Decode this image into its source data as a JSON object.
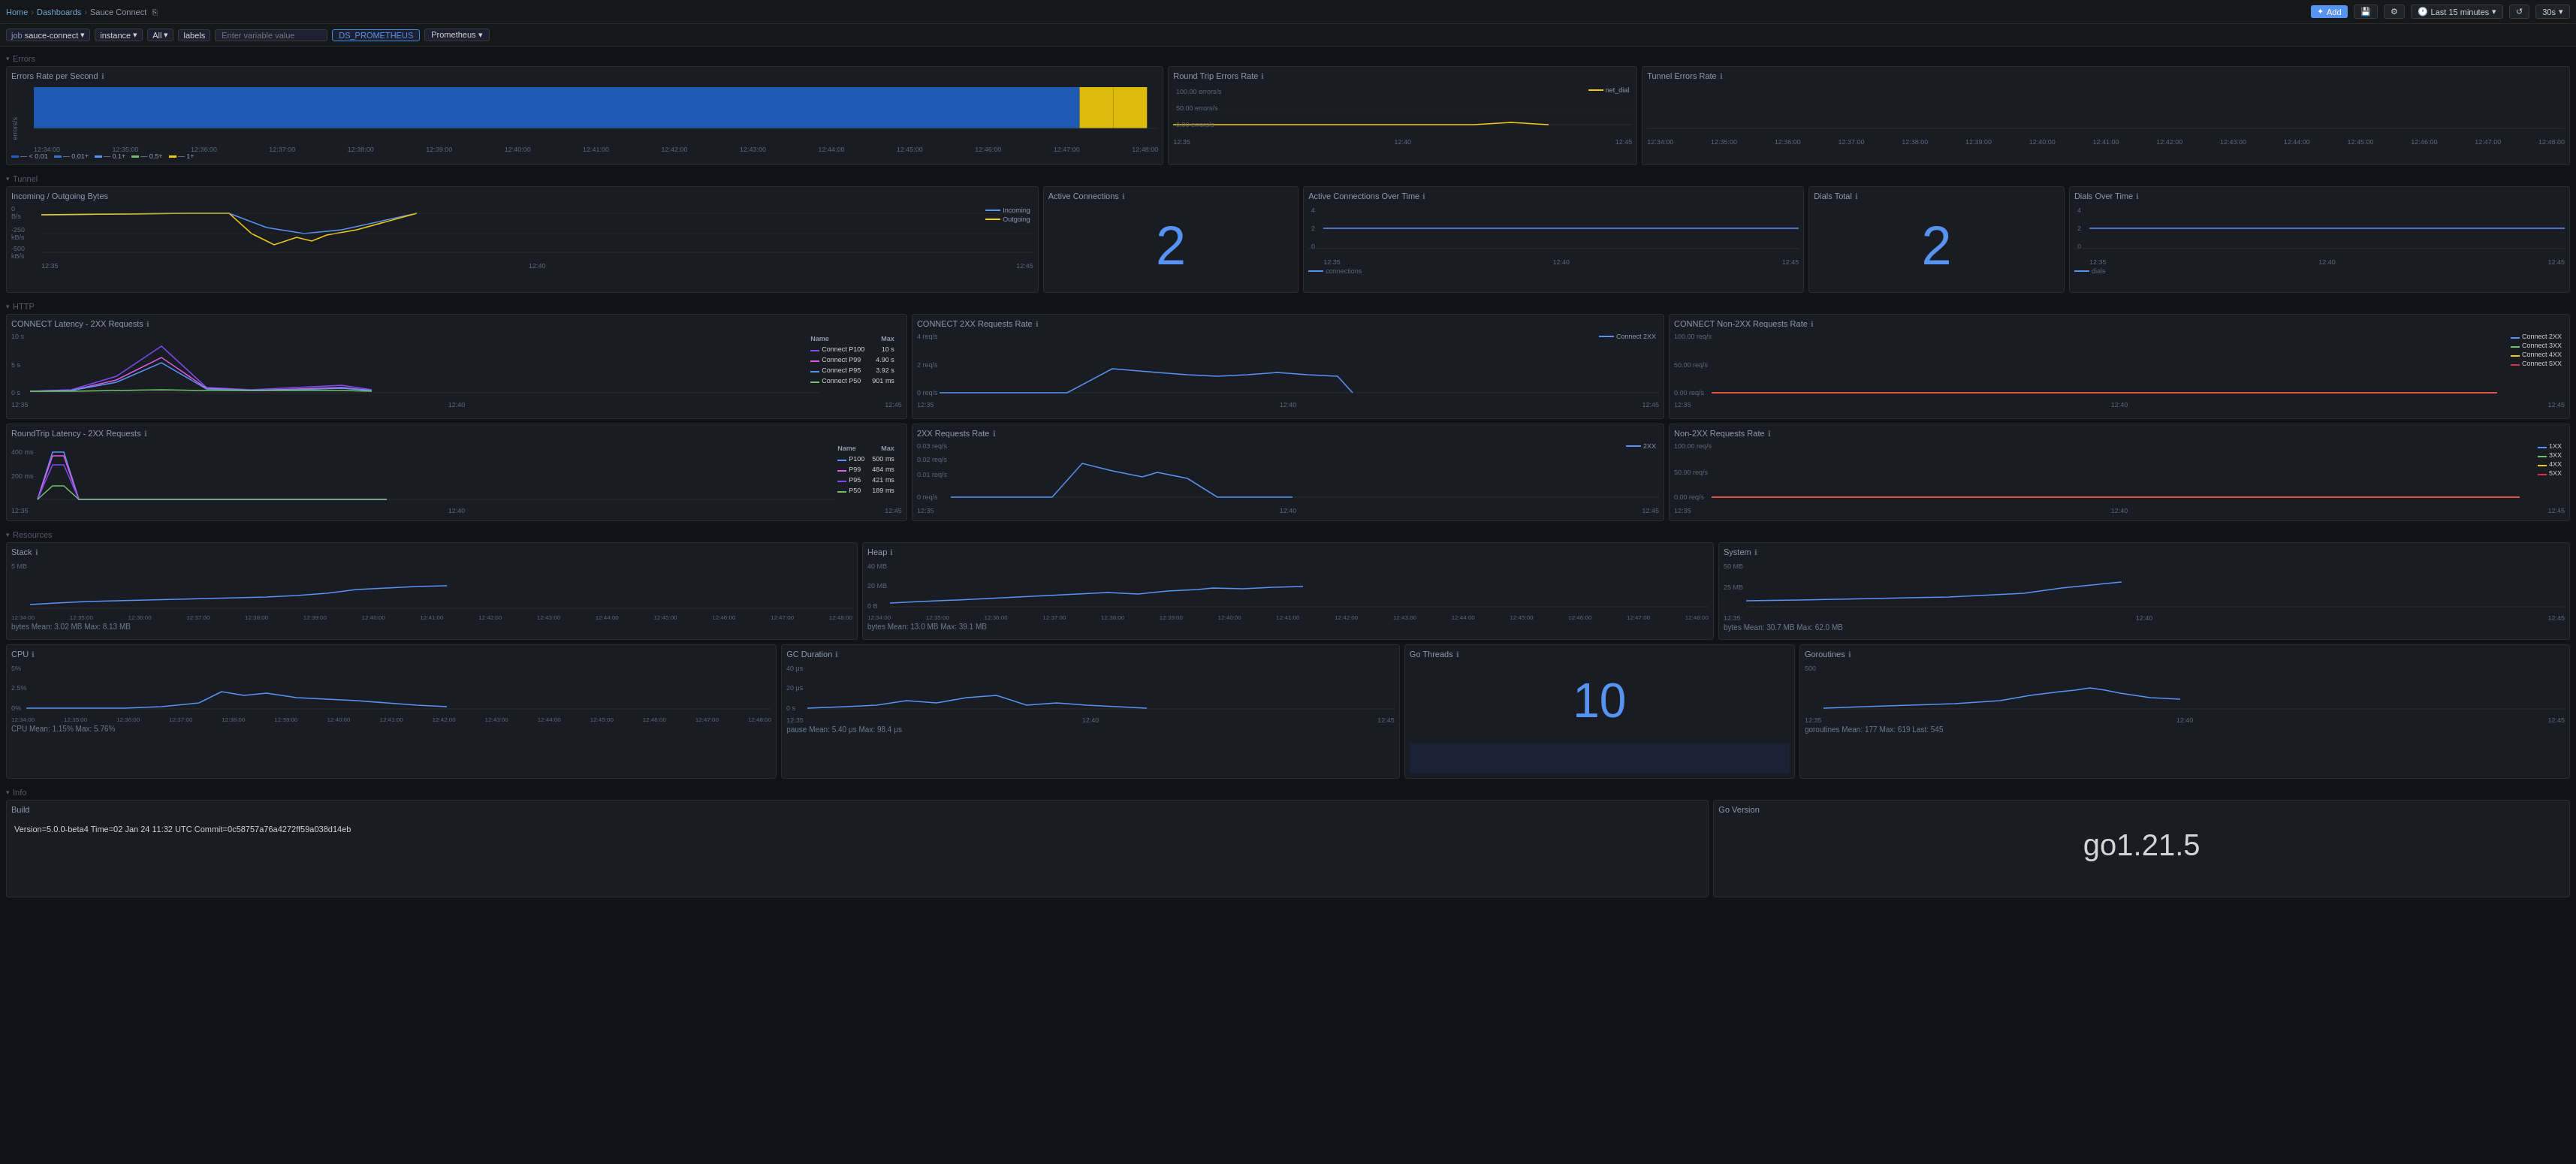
{
  "topbar": {
    "breadcrumb": [
      "Home",
      "Dashboards",
      "Sauce Connect"
    ],
    "add_label": "Add",
    "time_range": "Last 15 minutes",
    "refresh": "30s"
  },
  "filters": {
    "job_label": "job",
    "job_value": "sauce-connect",
    "instance_label": "instance",
    "all_label": "All",
    "labels_label": "labels",
    "variable_placeholder": "Enter variable value",
    "ds_button": "DS_PROMETHEUS",
    "prometheus_button": "Prometheus"
  },
  "sections": {
    "errors": "Errors",
    "tunnel": "Tunnel",
    "http": "HTTP",
    "resources": "Resources",
    "info": "Info"
  },
  "panels": {
    "errors_rate": {
      "title": "Errors Rate per Second",
      "y_label": "errors/s",
      "times": [
        "12:34:00",
        "12:35:00",
        "12:36:00",
        "12:37:00",
        "12:38:00",
        "12:39:00",
        "12:40:00",
        "12:41:00",
        "12:42:00",
        "12:43:00",
        "12:44:00",
        "12:45:00",
        "12:46:00",
        "12:47:00",
        "12:48:00"
      ],
      "legend": [
        {
          "color": "#1f60c4",
          "label": "< 0.01"
        },
        {
          "color": "#3274d9",
          "label": "0.01+"
        },
        {
          "color": "#5296f7",
          "label": "0.1+"
        },
        {
          "color": "#73bf69",
          "label": "0.5+"
        },
        {
          "color": "#f2cc0c",
          "label": "1+"
        }
      ]
    },
    "roundtrip_errors": {
      "title": "Round Trip Errors Rate",
      "y_values": [
        "100.00 errors/s",
        "50.00 errors/s",
        "0.00 errors/s"
      ],
      "times": [
        "12:35",
        "12:40",
        "12:45"
      ],
      "legend_item": "net_dial"
    },
    "tunnel_errors": {
      "title": "Tunnel Errors Rate",
      "times": [
        "12:34:00",
        "12:35:00",
        "12:36:00",
        "12:37:00",
        "12:38:00",
        "12:39:00",
        "12:40:00",
        "12:41:00",
        "12:42:00",
        "12:43:00",
        "12:44:00",
        "12:45:00",
        "12:46:00",
        "12:47:00",
        "12:48:00"
      ]
    },
    "incoming_outgoing": {
      "title": "Incoming / Outgoing Bytes",
      "y_values": [
        "0 B/s",
        "-250 kB/s",
        "-500 kB/s"
      ],
      "times": [
        "12:35",
        "12:40",
        "12:45"
      ],
      "legend": [
        {
          "color": "#5794f2",
          "label": "Incoming"
        },
        {
          "color": "#f2cc0c",
          "label": "Outgoing"
        }
      ]
    },
    "active_connections": {
      "title": "Active Connections",
      "value": "2"
    },
    "active_connections_over_time": {
      "title": "Active Connections Over Time",
      "y_values": [
        "4",
        "2",
        "0"
      ],
      "times": [
        "12:35",
        "12:40",
        "12:45"
      ],
      "legend_item": "connections"
    },
    "dials_total": {
      "title": "Dials Total",
      "value": "2"
    },
    "dials_over_time": {
      "title": "Dials Over Time",
      "y_values": [
        "4",
        "2",
        "0"
      ],
      "times": [
        "12:35",
        "12:40",
        "12:45"
      ],
      "legend_item": "dials"
    },
    "connect_latency": {
      "title": "CONNECT Latency - 2XX Requests",
      "y_values": [
        "10 s",
        "5 s",
        "0 s"
      ],
      "times": [
        "12:35",
        "12:40",
        "12:45"
      ],
      "legend": [
        {
          "color": "#7c4cf2",
          "label": "Connect P100",
          "max": "10 s"
        },
        {
          "color": "#e05ce2",
          "label": "Connect P99",
          "max": "4.90 s"
        },
        {
          "color": "#5794f2",
          "label": "Connect P95",
          "max": "3.92 s"
        },
        {
          "color": "#73bf69",
          "label": "Connect P50",
          "max": "901 ms"
        }
      ]
    },
    "connect_2xx_rate": {
      "title": "CONNECT 2XX Requests Rate",
      "y_values": [
        "4 req/s",
        "2 req/s",
        "0 req/s"
      ],
      "times": [
        "12:35",
        "12:40",
        "12:45"
      ],
      "legend_item": "Connect 2XX"
    },
    "connect_non2xx_rate": {
      "title": "CONNECT Non-2XX Requests Rate",
      "y_values": [
        "100.00 req/s",
        "50.00 req/s",
        "0.00 req/s"
      ],
      "times": [
        "12:35",
        "12:40",
        "12:45"
      ],
      "legend": [
        {
          "color": "#5794f2",
          "label": "Connect 2XX"
        },
        {
          "color": "#73bf69",
          "label": "Connect 3XX"
        },
        {
          "color": "#f2cc0c",
          "label": "Connect 4XX"
        },
        {
          "color": "#e02f44",
          "label": "Connect 5XX"
        }
      ]
    },
    "roundtrip_latency": {
      "title": "RoundTrip Latency - 2XX Requests",
      "y_values": [
        "400 ms",
        "200 ms"
      ],
      "times": [
        "12:35",
        "12:40",
        "12:45"
      ],
      "legend": [
        {
          "color": "#5794f2",
          "label": "P100",
          "max": "500 ms"
        },
        {
          "color": "#e05ce2",
          "label": "P99",
          "max": "484 ms"
        },
        {
          "color": "#7c4cf2",
          "label": "P95",
          "max": "421 ms"
        },
        {
          "color": "#73bf69",
          "label": "P50",
          "max": "189 ms"
        }
      ]
    },
    "requests_2xx_rate": {
      "title": "2XX Requests Rate",
      "y_values": [
        "0.03 req/s",
        "0.02 req/s",
        "0.01 req/s",
        "0 req/s"
      ],
      "times": [
        "12:35",
        "12:40",
        "12:45"
      ],
      "legend_item": "2XX"
    },
    "non2xx_requests_rate": {
      "title": "Non-2XX Requests Rate",
      "y_values": [
        "100.00 req/s",
        "50.00 req/s",
        "0.00 req/s"
      ],
      "times": [
        "12:35",
        "12:40",
        "12:45"
      ],
      "legend": [
        {
          "color": "#5794f2",
          "label": "1XX"
        },
        {
          "color": "#73bf69",
          "label": "3XX"
        },
        {
          "color": "#f2cc0c",
          "label": "4XX"
        },
        {
          "color": "#e02f44",
          "label": "5XX"
        }
      ]
    },
    "stack": {
      "title": "Stack",
      "y_value": "5 MB",
      "times": [
        "12:34:00",
        "12:35:00",
        "12:36:00",
        "12:37:00",
        "12:38:00",
        "12:39:00",
        "12:40:00",
        "12:41:00",
        "12:42:00",
        "12:43:00",
        "12:44:00",
        "12:45:00",
        "12:46:00",
        "12:47:00",
        "12:48:00"
      ],
      "stat": "bytes  Mean: 3.02 MB  Max: 8.13 MB"
    },
    "heap": {
      "title": "Heap",
      "y_values": [
        "40 MB",
        "20 MB",
        "0 B"
      ],
      "times": [
        "12:34:00",
        "12:35:00",
        "12:36:00",
        "12:37:00",
        "12:38:00",
        "12:39:00",
        "12:40:00",
        "12:41:00",
        "12:42:00",
        "12:43:00",
        "12:44:00",
        "12:45:00",
        "12:46:00",
        "12:47:00",
        "12:48:00"
      ],
      "stat": "bytes  Mean: 13.0 MB  Max: 39.1 MB"
    },
    "system": {
      "title": "System",
      "y_values": [
        "50 MB",
        "25 MB"
      ],
      "times": [
        "12:35",
        "12:40",
        "12:45"
      ],
      "stat": "bytes  Mean: 30.7 MB  Max: 62.0 MB"
    },
    "cpu": {
      "title": "CPU",
      "y_values": [
        "5%",
        "2.5%",
        "0%"
      ],
      "times": [
        "12:34:00",
        "12:35:00",
        "12:36:00",
        "12:37:00",
        "12:38:00",
        "12:39:00",
        "12:40:00",
        "12:41:00",
        "12:42:00",
        "12:43:00",
        "12:44:00",
        "12:45:00",
        "12:46:00",
        "12:47:00",
        "12:48:00"
      ],
      "stat": "CPU  Mean: 1.15%  Max: 5.76%"
    },
    "gc_duration": {
      "title": "GC Duration",
      "y_values": [
        "40 μs",
        "20 μs",
        "0 s"
      ],
      "times": [
        "12:35",
        "12:40",
        "12:45"
      ],
      "stat": "pause  Mean: 5.40 μs  Max: 98.4 μs"
    },
    "go_threads": {
      "title": "Go Threads",
      "value": "10"
    },
    "goroutines": {
      "title": "Goroutines",
      "y_value": "500",
      "times": [
        "12:35",
        "12:40",
        "12:45"
      ],
      "stat": "goroutines  Mean: 177  Max: 619  Last: 545"
    },
    "build": {
      "title": "Build",
      "value": "Version=5.0.0-beta4 Time=02 Jan 24 11:32 UTC Commit=0c58757a76a4272ff59a038d14eb"
    },
    "go_version": {
      "title": "Go Version",
      "value": "go1.21.5"
    }
  }
}
